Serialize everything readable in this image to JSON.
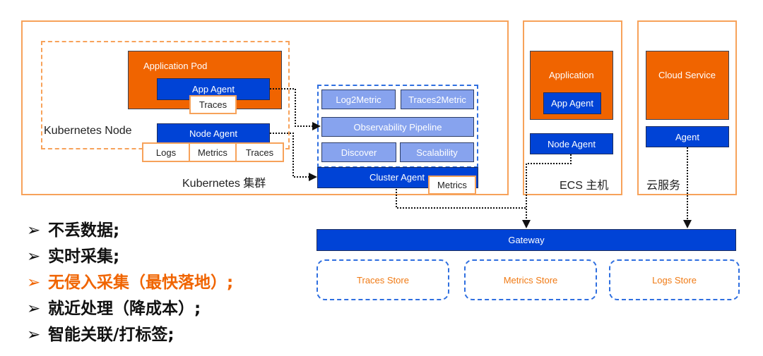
{
  "colors": {
    "orange": "#f06400",
    "blue": "#0043d6",
    "light_blue": "#87a3ee",
    "frame_orange": "#f7a25a",
    "dash_blue": "#2f6fe0",
    "highlight_text": "#f06400"
  },
  "k8s_cluster": {
    "label": "Kubernetes 集群",
    "node": {
      "label": "Kubernetes Node",
      "app_pod": {
        "label": "Application Pod",
        "agent": "App Agent",
        "tag": "Traces"
      },
      "node_agent": {
        "label": "Node Agent",
        "tags": [
          "Logs",
          "Metrics",
          "Traces"
        ]
      }
    },
    "cluster_agent": {
      "modules": [
        "Log2Metric",
        "Traces2Metric",
        "Observability Pipeline",
        "Discover",
        "Scalability"
      ],
      "label": "Cluster Agent",
      "tag": "Metrics"
    }
  },
  "ecs_host": {
    "label": "ECS 主机",
    "application": "Application",
    "app_agent": "App Agent",
    "node_agent": "Node Agent"
  },
  "cloud_service": {
    "label": "云服务",
    "service": "Cloud Service",
    "agent": "Agent"
  },
  "gateway": {
    "label": "Gateway"
  },
  "stores": [
    "Traces Store",
    "Metrics Store",
    "Logs Store"
  ],
  "bullets": [
    {
      "marker": "➢",
      "text": "不丢数据;",
      "highlight": false
    },
    {
      "marker": "➢",
      "text": "实时采集;",
      "highlight": false
    },
    {
      "marker": "➢",
      "text": "无侵入采集（最快落地）;",
      "highlight": true
    },
    {
      "marker": "➢",
      "text": "就近处理（降成本）;",
      "highlight": false
    },
    {
      "marker": "➢",
      "text": "智能关联/打标签;",
      "highlight": false
    }
  ]
}
